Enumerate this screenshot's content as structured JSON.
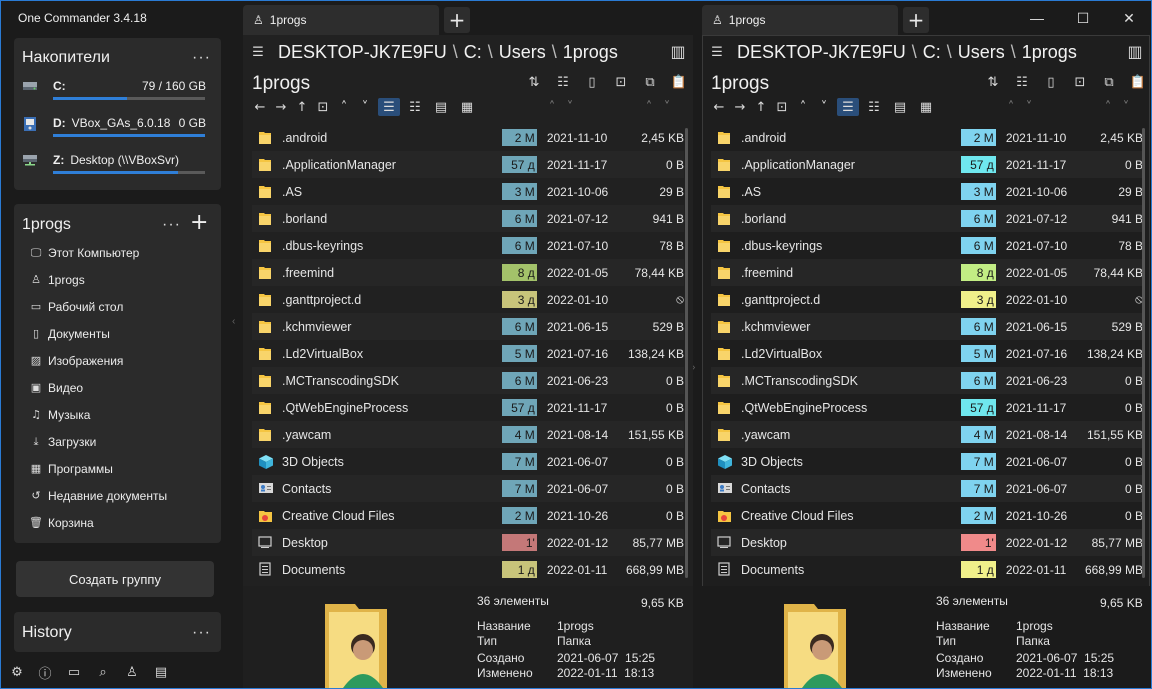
{
  "app": {
    "title": "One Commander 3.4.18"
  },
  "window_controls": {
    "minimize": "—",
    "maximize": "☐",
    "close": "✕"
  },
  "colors": {
    "accent": "#2f7fd8",
    "age_blue_l": "#6fa6b8",
    "age_green_l": "#a3c26a",
    "age_yellow_l": "#c8c47a",
    "age_red_l": "#c47878",
    "age_blue_r": "#7fd3ef",
    "age_green_r": "#c2ed84",
    "age_yellow_r": "#f0f08a",
    "age_red_r": "#f08a8a",
    "age_cyan_r": "#6fe7ee"
  },
  "drives": {
    "title": "Накопители",
    "more": "···",
    "items": [
      {
        "name": "C:",
        "size": "79 / 160 GB",
        "fill": 0.49,
        "icon": "hard-drive-icon"
      },
      {
        "name": "D:",
        "label": "VBox_GAs_6.0.18",
        "size": "0 GB",
        "fill": 1.0,
        "icon": "cd-drive-icon"
      },
      {
        "name": "Z:",
        "label": "Desktop (\\\\VBoxSvr)",
        "size": "",
        "fill": 0.82,
        "icon": "network-drive-icon"
      }
    ]
  },
  "favorites": {
    "title": "1progs",
    "more": "···",
    "add": "+",
    "items": [
      {
        "label": "Этот Компьютер",
        "icon": "computer-icon"
      },
      {
        "label": "1progs",
        "icon": "user-icon"
      },
      {
        "label": "Рабочий стол",
        "icon": "desktop-icon"
      },
      {
        "label": "Документы",
        "icon": "documents-icon"
      },
      {
        "label": "Изображения",
        "icon": "images-icon"
      },
      {
        "label": "Видео",
        "icon": "video-icon"
      },
      {
        "label": "Музыка",
        "icon": "music-icon"
      },
      {
        "label": "Загрузки",
        "icon": "downloads-icon"
      },
      {
        "label": "Программы",
        "icon": "programs-icon"
      },
      {
        "label": "Недавние документы",
        "icon": "recent-icon"
      },
      {
        "label": "Корзина",
        "icon": "trash-icon"
      }
    ]
  },
  "create_group": "Создать группу",
  "history": {
    "title": "History",
    "more": "···"
  },
  "panes": [
    {
      "tab": "1progs",
      "path": {
        "root": "DESKTOP-JK7E9FU",
        "sep": "\\",
        "drive": "C:",
        "p1": "Users",
        "p2": "1progs"
      },
      "folder": "1progs",
      "info": {
        "count": "36 элементы",
        "size": "9,65 KB",
        "name_label": "Название",
        "name": "1progs",
        "type_label": "Тип",
        "type": "Папка",
        "created_label": "Создано",
        "created": "2021-06-07  15:25",
        "modified_label": "Изменено",
        "modified": "2022-01-11  18:13"
      }
    },
    {
      "tab": "1progs",
      "path": {
        "root": "DESKTOP-JK7E9FU",
        "sep": "\\",
        "drive": "C:",
        "p1": "Users",
        "p2": "1progs"
      },
      "folder": "1progs",
      "info": {
        "count": "36 элементы",
        "size": "9,65 KB",
        "name_label": "Название",
        "name": "1progs",
        "type_label": "Тип",
        "type": "Папка",
        "created_label": "Создано",
        "created": "2021-06-07  15:25",
        "modified_label": "Изменено",
        "modified": "2022-01-11  18:13"
      }
    }
  ],
  "files": [
    {
      "name": ".android",
      "age": "2 M",
      "age_tone": "blue",
      "date": "2021-11-10",
      "size": "2,45 KB",
      "icon": "folder"
    },
    {
      "name": ".ApplicationManager",
      "age": "57 д",
      "age_tone": "cyan",
      "date": "2021-11-17",
      "size": "0 B",
      "icon": "folder"
    },
    {
      "name": ".AS",
      "age": "3 M",
      "age_tone": "blue",
      "date": "2021-10-06",
      "size": "29 B",
      "icon": "folder"
    },
    {
      "name": ".borland",
      "age": "6 M",
      "age_tone": "blue",
      "date": "2021-07-12",
      "size": "941 B",
      "icon": "folder"
    },
    {
      "name": ".dbus-keyrings",
      "age": "6 M",
      "age_tone": "blue",
      "date": "2021-07-10",
      "size": "78 B",
      "icon": "folder"
    },
    {
      "name": ".freemind",
      "age": "8 д",
      "age_tone": "green",
      "date": "2022-01-05",
      "size": "78,44 KB",
      "icon": "folder"
    },
    {
      "name": ".ganttproject.d",
      "age": "3 д",
      "age_tone": "yellow",
      "date": "2022-01-10",
      "size": "⦸",
      "icon": "folder"
    },
    {
      "name": ".kchmviewer",
      "age": "6 M",
      "age_tone": "blue",
      "date": "2021-06-15",
      "size": "529 B",
      "icon": "folder"
    },
    {
      "name": ".Ld2VirtualBox",
      "age": "5 M",
      "age_tone": "blue",
      "date": "2021-07-16",
      "size": "138,24 KB",
      "icon": "folder"
    },
    {
      "name": ".MCTranscodingSDK",
      "age": "6 M",
      "age_tone": "blue",
      "date": "2021-06-23",
      "size": "0 B",
      "icon": "folder"
    },
    {
      "name": ".QtWebEngineProcess",
      "age": "57 д",
      "age_tone": "cyan",
      "date": "2021-11-17",
      "size": "0 B",
      "icon": "folder"
    },
    {
      "name": ".yawcam",
      "age": "4 M",
      "age_tone": "blue",
      "date": "2021-08-14",
      "size": "151,55 KB",
      "icon": "folder"
    },
    {
      "name": "3D Objects",
      "age": "7 M",
      "age_tone": "blue",
      "date": "2021-06-07",
      "size": "0 B",
      "icon": "3d"
    },
    {
      "name": "Contacts",
      "age": "7 M",
      "age_tone": "blue",
      "date": "2021-06-07",
      "size": "0 B",
      "icon": "contacts"
    },
    {
      "name": "Creative Cloud Files",
      "age": "2 M",
      "age_tone": "blue",
      "date": "2021-10-26",
      "size": "0 B",
      "icon": "cc"
    },
    {
      "name": "Desktop",
      "age": "1'",
      "age_tone": "red",
      "date": "2022-01-12",
      "size": "85,77 MB",
      "icon": "desktop"
    },
    {
      "name": "Documents",
      "age": "1 д",
      "age_tone": "yellow",
      "date": "2022-01-11",
      "size": "668,99 MB",
      "icon": "doc"
    }
  ]
}
